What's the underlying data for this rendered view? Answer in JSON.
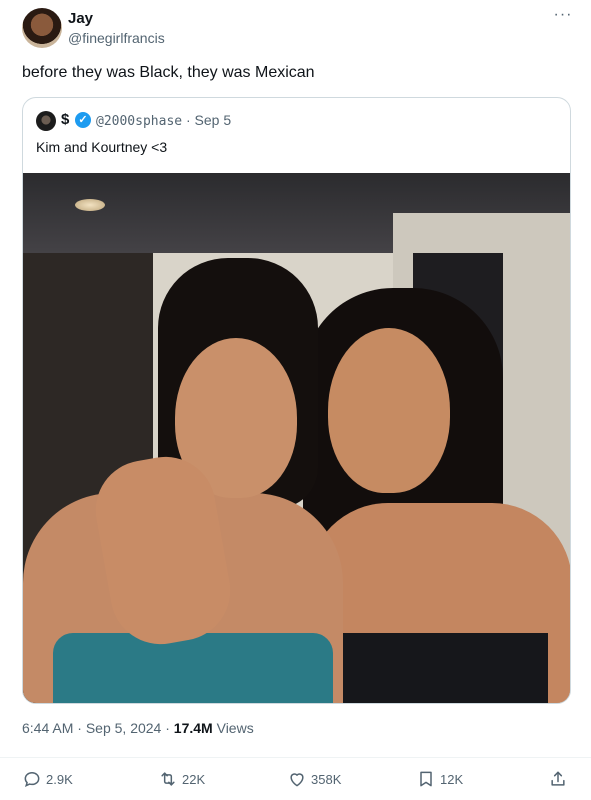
{
  "author": {
    "name": "Jay",
    "handle": "@finegirlfrancis"
  },
  "more_glyph": "···",
  "tweet_text": "before they was Black, they was Mexican",
  "quote": {
    "name": "$",
    "verified_glyph": "✓",
    "handle": "@2000sphase",
    "separator": "·",
    "date": "Sep 5",
    "text": "Kim and Kourtney <3"
  },
  "meta": {
    "time": "6:44 AM",
    "sep1": "·",
    "date": "Sep 5, 2024",
    "sep2": "·",
    "views_count": "17.4M",
    "views_label": "Views"
  },
  "actions": {
    "reply_count": "2.9K",
    "retweet_count": "22K",
    "like_count": "358K",
    "bookmark_count": "12K"
  },
  "icons": {
    "reply": "speech-bubble-icon",
    "retweet": "retweet-arrows-icon",
    "like": "heart-icon",
    "bookmark": "bookmark-icon",
    "share": "share-upload-icon"
  },
  "colors": {
    "text_primary": "#0f1419",
    "text_secondary": "#536471",
    "verified": "#1d9bf0",
    "border": "#cfd9de"
  }
}
